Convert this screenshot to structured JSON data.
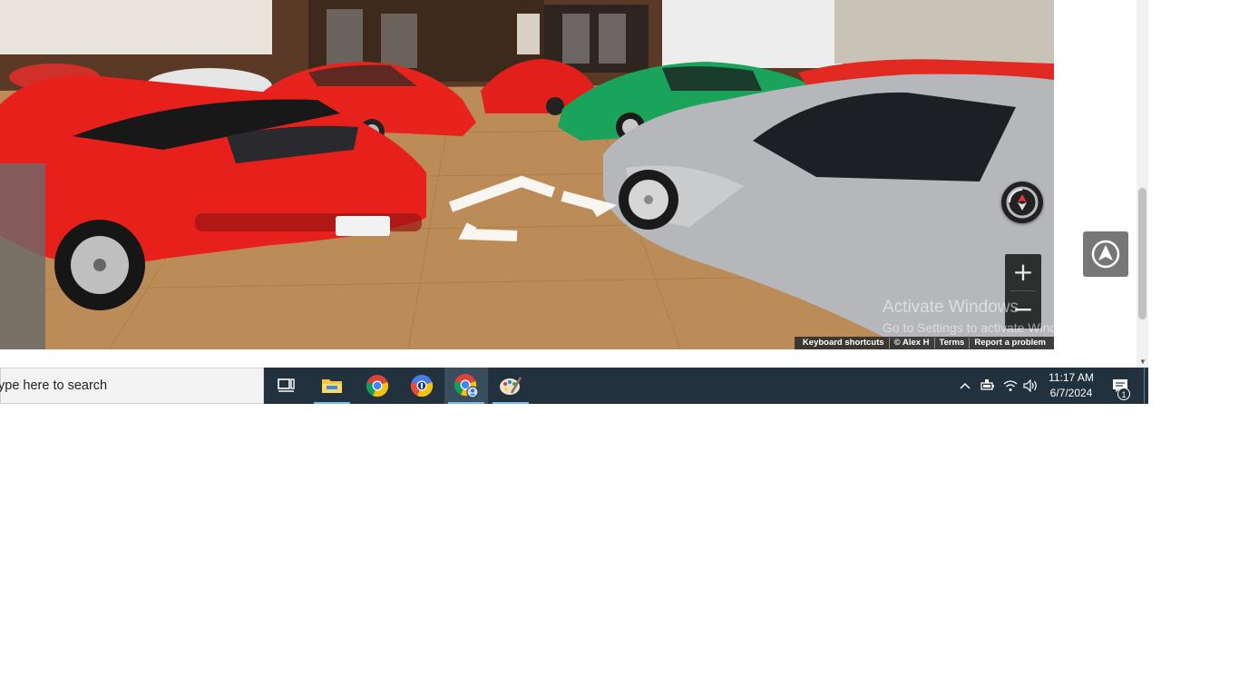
{
  "streetview": {
    "attribution": {
      "keyboard_shortcuts": "Keyboard shortcuts",
      "copyright": "© Alex H",
      "terms": "Terms",
      "report": "Report a problem"
    },
    "zoom_in_symbol": "+",
    "zoom_out_symbol": "−",
    "compass_icon": "compass-icon",
    "move_arrow_icon": "navigation-arrow-icon"
  },
  "windows_watermark": {
    "title": "Activate Windows",
    "subtitle": "Go to Settings to activate Windows."
  },
  "pegman_icon": "pegman-up-arrow-icon",
  "taskbar": {
    "search_placeholder": "ype here to search",
    "apps": [
      {
        "name": "task-view",
        "icon": "task-view-icon"
      },
      {
        "name": "file-explorer",
        "icon": "folder-icon"
      },
      {
        "name": "chrome",
        "icon": "chrome-icon"
      },
      {
        "name": "chrome-beta",
        "icon": "chrome-beta-icon"
      },
      {
        "name": "chrome-profile",
        "icon": "chrome-profile-icon"
      },
      {
        "name": "paint",
        "icon": "paint-palette-icon"
      }
    ],
    "tray_icons": [
      "chevron-up-icon",
      "battery-icon",
      "wifi-icon",
      "speaker-icon"
    ],
    "time": "11:17 AM",
    "date": "6/7/2024",
    "notification_count": "1"
  },
  "colors": {
    "taskbar_bg": "#21313d",
    "active_underline": "#76b9ed",
    "car_red": "#e8201c",
    "car_green": "#1fa35b",
    "car_silver": "#b9bbbe"
  }
}
